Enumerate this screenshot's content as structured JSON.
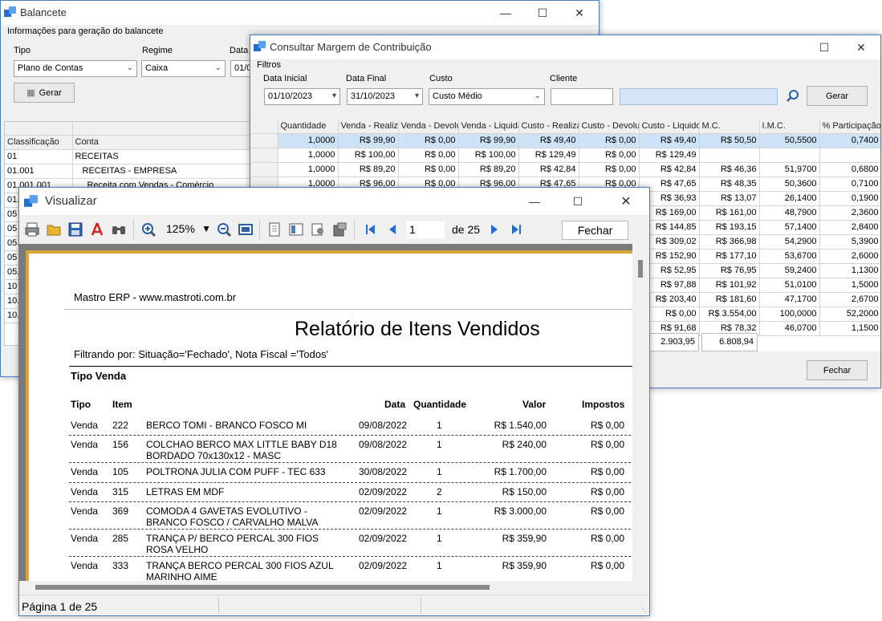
{
  "balancete": {
    "title": "Balancete",
    "section_label": "Informações para geração do balancete",
    "tipo_label": "Tipo",
    "tipo_value": "Plano de Contas",
    "regime_label": "Regime",
    "regime_value": "Caixa",
    "data_label": "Data",
    "data_value": "01/0",
    "gerar_label": "Gerar",
    "columns": [
      "Classificação",
      "Conta"
    ],
    "rows": [
      {
        "class": "01",
        "conta": "RECEITAS",
        "bold": true
      },
      {
        "class": "01.001",
        "conta": "RECEITAS - EMPRESA",
        "bold": true
      },
      {
        "class": "01.001.001",
        "conta": "Receita com Vendas - Comércio",
        "bold": false
      },
      {
        "class": "01.0",
        "conta": "",
        "bold": true
      },
      {
        "class": "05",
        "conta": "",
        "bold": true
      },
      {
        "class": "05",
        "conta": "",
        "bold": true
      },
      {
        "class": "05.0",
        "conta": "",
        "bold": false
      },
      {
        "class": "05",
        "conta": "",
        "bold": true
      },
      {
        "class": "05.0",
        "conta": "",
        "bold": false
      },
      {
        "class": "10",
        "conta": "",
        "bold": true
      },
      {
        "class": "10.",
        "conta": "",
        "bold": true
      },
      {
        "class": "10.",
        "conta": "",
        "bold": true
      }
    ]
  },
  "margem": {
    "title": "Consultar Margem de Contribuição",
    "filtros_label": "Filtros",
    "data_inicial_label": "Data Inicial",
    "data_inicial_value": "01/10/2023",
    "data_final_label": "Data Final",
    "data_final_value": "31/10/2023",
    "custo_label": "Custo",
    "custo_value": "Custo Médio",
    "cliente_label": "Cliente",
    "cliente_value": "",
    "gerar_label": "Gerar",
    "fechar_label": "Fechar",
    "columns": [
      "Quantidade",
      "Venda - Realiza",
      "Venda - Devolu",
      "Venda - Liquida",
      "Custo - Realiza",
      "Custo - Devolu",
      "Custo - Liquido",
      "M.C.",
      "I.M.C.",
      "% Participação"
    ],
    "rows": [
      [
        "1,0000",
        "R$ 99,90",
        "R$ 0,00",
        "R$ 99,90",
        "R$ 49,40",
        "R$ 0,00",
        "R$ 49,40",
        "R$ 50,50",
        "50,5500",
        "0,7400"
      ],
      [
        "1,0000",
        "R$ 100,00",
        "R$ 0,00",
        "R$ 100,00",
        "R$ 129,49",
        "R$ 0,00",
        "R$ 129,49",
        "",
        "",
        ""
      ],
      [
        "1,0000",
        "R$ 89,20",
        "R$ 0,00",
        "R$ 89,20",
        "R$ 42,84",
        "R$ 0,00",
        "R$ 42,84",
        "R$ 46,36",
        "51,9700",
        "0,6800"
      ],
      [
        "1,0000",
        "R$ 96,00",
        "R$ 0,00",
        "R$ 96,00",
        "R$ 47,65",
        "R$ 0,00",
        "R$ 47,65",
        "R$ 48,35",
        "50,3600",
        "0,7100"
      ],
      [
        "",
        "",
        "",
        "",
        "",
        "",
        "R$ 36,93",
        "R$ 13,07",
        "26,1400",
        "0,1900"
      ],
      [
        "",
        "",
        "",
        "",
        "",
        "",
        "R$ 169,00",
        "R$ 161,00",
        "48,7900",
        "2,3600"
      ],
      [
        "",
        "",
        "",
        "",
        "",
        "",
        "R$ 144,85",
        "R$ 193,15",
        "57,1400",
        "2,8400"
      ],
      [
        "",
        "",
        "",
        "",
        "",
        "",
        "R$ 309,02",
        "R$ 366,98",
        "54,2900",
        "5,3900"
      ],
      [
        "",
        "",
        "",
        "",
        "",
        "",
        "R$ 152,90",
        "R$ 177,10",
        "53,6700",
        "2,6000"
      ],
      [
        "",
        "",
        "",
        "",
        "",
        "",
        "R$ 52,95",
        "R$ 76,95",
        "59,2400",
        "1,1300"
      ],
      [
        "",
        "",
        "",
        "",
        "",
        "",
        "R$ 97,88",
        "R$ 101,92",
        "51,0100",
        "1,5000"
      ],
      [
        "",
        "",
        "",
        "",
        "",
        "",
        "R$ 203,40",
        "R$ 181,60",
        "47,1700",
        "2,6700"
      ],
      [
        "",
        "",
        "",
        "",
        "",
        "",
        "R$ 0,00",
        "R$ 3.554,00",
        "100,0000",
        "52,2000"
      ],
      [
        "",
        "",
        "",
        "",
        "",
        "",
        "R$ 91,68",
        "R$ 78,32",
        "46,0700",
        "1,1500"
      ]
    ],
    "total_1": "2.903,95",
    "total_2": "6.808,94"
  },
  "visualizar": {
    "title": "Visualizar",
    "zoom_value": "125%",
    "page_input": "1",
    "page_of": "de 25",
    "fechar_label": "Fechar",
    "status_page": "Página 1 de 25",
    "report": {
      "company": "Mastro ERP - www.mastroti.com.br",
      "title": "Relatório de Itens Vendidos",
      "filter": "Filtrando por: Situação='Fechado', Nota Fiscal ='Todos'",
      "group": "Tipo Venda",
      "headers": {
        "tipo": "Tipo",
        "item": "Item",
        "data": "Data",
        "quantidade": "Quantidade",
        "valor": "Valor",
        "impostos": "Impostos"
      },
      "rows": [
        {
          "tipo": "Venda",
          "item": "222",
          "desc": "BERCO TOMI - BRANCO FOSCO MI",
          "desc2": "",
          "data": "09/08/2022",
          "qtd": "1",
          "valor": "R$ 1.540,00",
          "imp": "R$ 0,00"
        },
        {
          "tipo": "Venda",
          "item": "156",
          "desc": "COLCHAO BERCO MAX LITTLE BABY D18",
          "desc2": "BORDADO 70x130x12 - MASC",
          "data": "09/08/2022",
          "qtd": "1",
          "valor": "R$ 240,00",
          "imp": "R$ 0,00"
        },
        {
          "tipo": "Venda",
          "item": "105",
          "desc": "POLTRONA JULIA COM PUFF - TEC 633",
          "desc2": "",
          "data": "30/08/2022",
          "qtd": "1",
          "valor": "R$ 1.700,00",
          "imp": "R$ 0,00"
        },
        {
          "tipo": "Venda",
          "item": "315",
          "desc": "LETRAS EM MDF",
          "desc2": "",
          "data": "02/09/2022",
          "qtd": "2",
          "valor": "R$ 150,00",
          "imp": "R$ 0,00"
        },
        {
          "tipo": "Venda",
          "item": "369",
          "desc": "COMODA 4 GAVETAS EVOLUTIVO -",
          "desc2": "BRANCO FOSCO / CARVALHO MALVA",
          "data": "02/09/2022",
          "qtd": "1",
          "valor": "R$ 3.000,00",
          "imp": "R$ 0,00"
        },
        {
          "tipo": "Venda",
          "item": "285",
          "desc": "TRANÇA P/ BERCO PERCAL 300 FIOS",
          "desc2": "ROSA VELHO",
          "data": "02/09/2022",
          "qtd": "1",
          "valor": "R$ 359,90",
          "imp": "R$ 0,00"
        },
        {
          "tipo": "Venda",
          "item": "333",
          "desc": "TRANÇA BERCO PERCAL 300 FIOS AZUL",
          "desc2": "MARINHO AIME",
          "data": "02/09/2022",
          "qtd": "1",
          "valor": "R$ 359,90",
          "imp": "R$ 0,00"
        }
      ]
    }
  }
}
